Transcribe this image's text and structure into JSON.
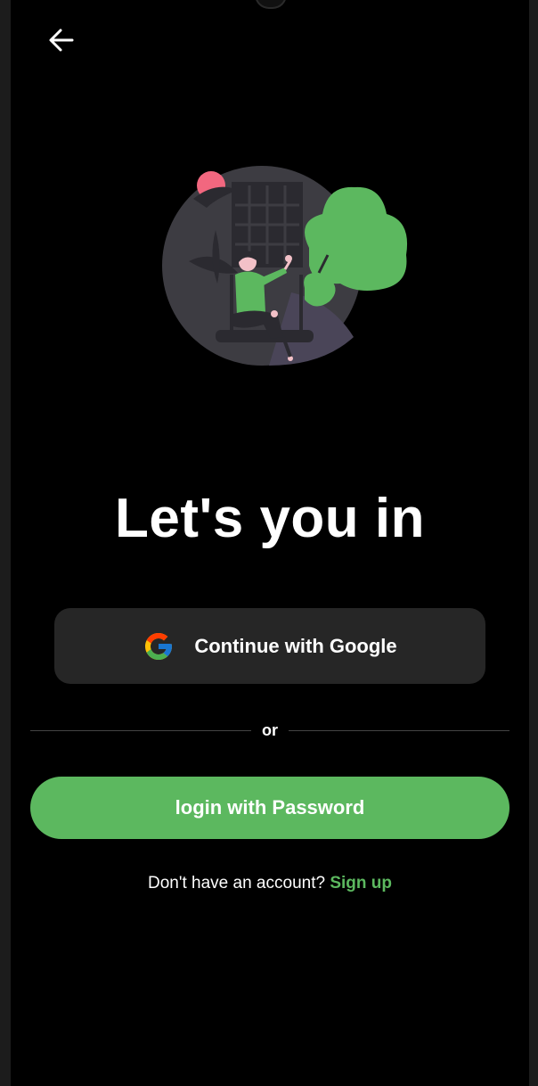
{
  "header": {
    "back_icon": "arrow-left-icon"
  },
  "illustration": {
    "icon": "person-on-swing-illustration"
  },
  "main": {
    "title": "Let's you in",
    "google_button_label": "Continue with Google",
    "google_icon": "google-icon",
    "divider_text": "or",
    "password_button_label": "login with Password",
    "signup_prompt": "Don't have an account?",
    "signup_link": "Sign up"
  },
  "colors": {
    "background": "#000000",
    "accent": "#5cb85f",
    "button_dark": "#262626",
    "text": "#ffffff"
  }
}
